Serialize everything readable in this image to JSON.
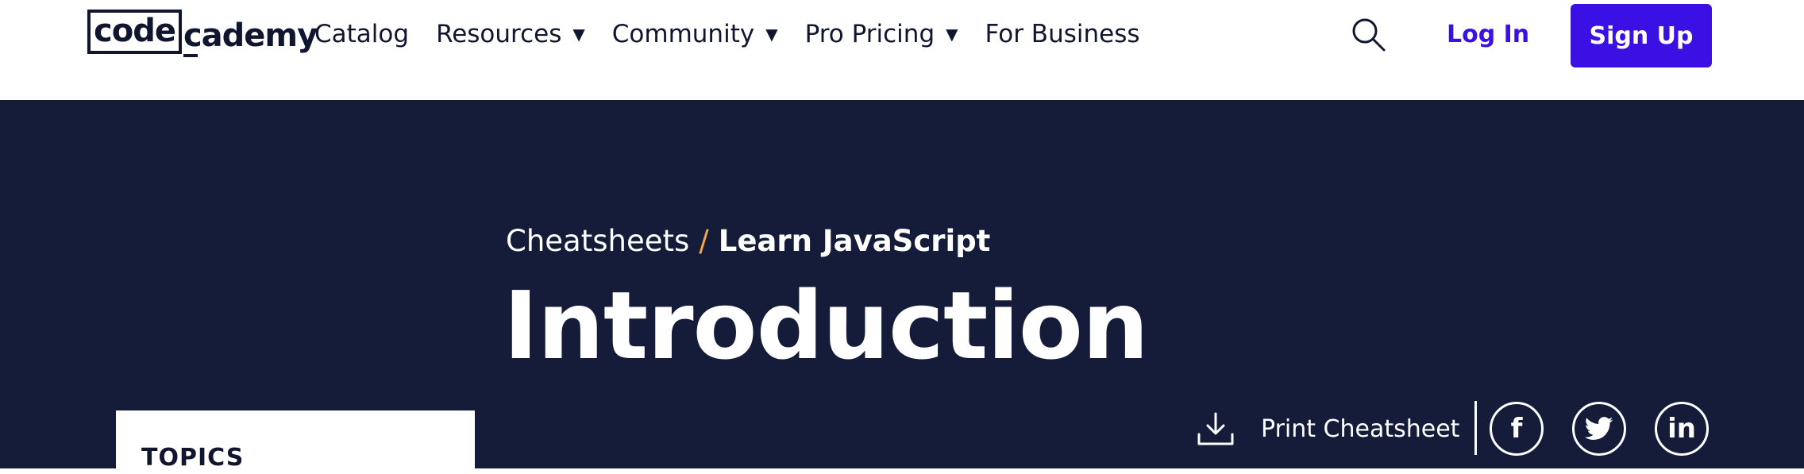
{
  "header": {
    "logo": {
      "boxed": "code",
      "rest": "cademy"
    },
    "nav": [
      {
        "label": "Catalog",
        "has_caret": false
      },
      {
        "label": "Resources",
        "has_caret": true
      },
      {
        "label": "Community",
        "has_caret": true
      },
      {
        "label": "Pro Pricing",
        "has_caret": true
      },
      {
        "label": "For Business",
        "has_caret": false
      }
    ],
    "search_icon": "search-icon",
    "login_label": "Log In",
    "signup_label": "Sign Up"
  },
  "hero": {
    "breadcrumb": {
      "parent": "Cheatsheets",
      "separator": "/",
      "current": "Learn JavaScript"
    },
    "title": "Introduction",
    "print_label": "Print Cheatsheet",
    "social": [
      "facebook-icon",
      "twitter-icon",
      "linkedin-icon"
    ]
  },
  "sidebar": {
    "topics_label": "TOPICS"
  },
  "colors": {
    "brand_navy": "#10162f",
    "hero_background": "#141c3a",
    "accent_purple": "#3a10e5",
    "breadcrumb_separator": "#f5a54a"
  }
}
